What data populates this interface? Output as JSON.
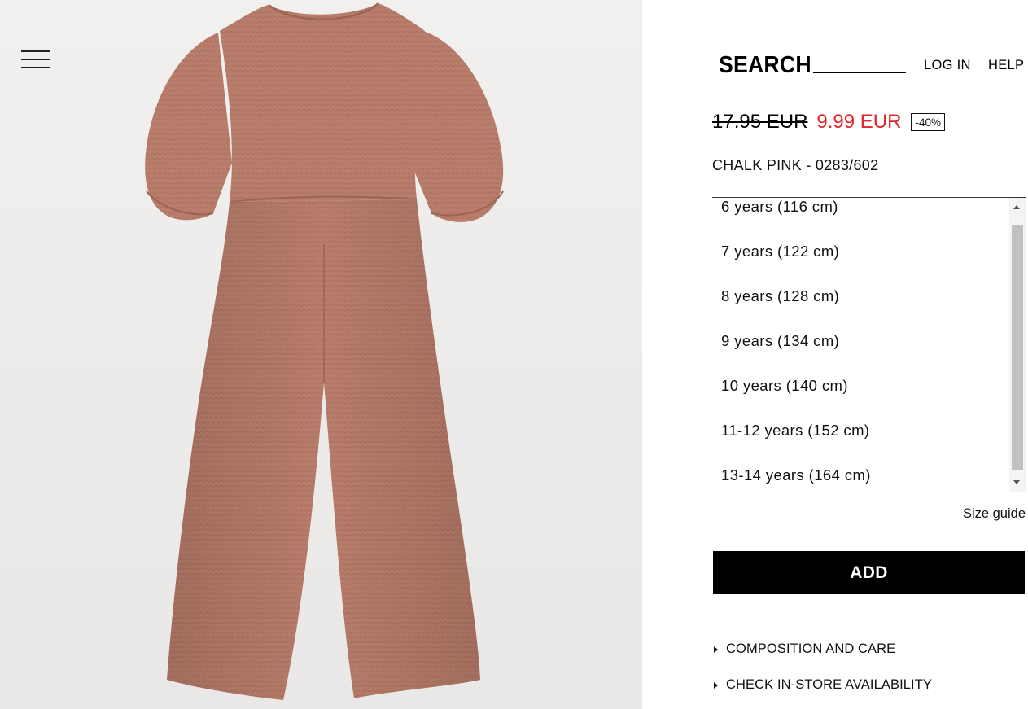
{
  "header": {
    "search_label": "SEARCH",
    "login_label": "LOG IN",
    "help_label": "HELP",
    "menu_icon": "hamburger-menu-icon"
  },
  "product": {
    "old_price": "17.95 EUR",
    "new_price": "9.99 EUR",
    "discount": "-40%",
    "color_ref": "CHALK PINK - 0283/602",
    "image_alt": "Chalk pink textured jumpsuit with puff sleeves",
    "colors": {
      "sale_price": "#e0262b",
      "garment": "#b97d6b"
    }
  },
  "sizes": [
    "6 years (116 cm)",
    "7 years (122 cm)",
    "8 years (128 cm)",
    "9 years (134 cm)",
    "10 years (140 cm)",
    "11-12 years (152 cm)",
    "13-14 years (164 cm)"
  ],
  "size_guide_label": "Size guide",
  "add_label": "ADD",
  "accordions": {
    "composition": "COMPOSITION AND CARE",
    "availability": "CHECK IN-STORE AVAILABILITY"
  }
}
